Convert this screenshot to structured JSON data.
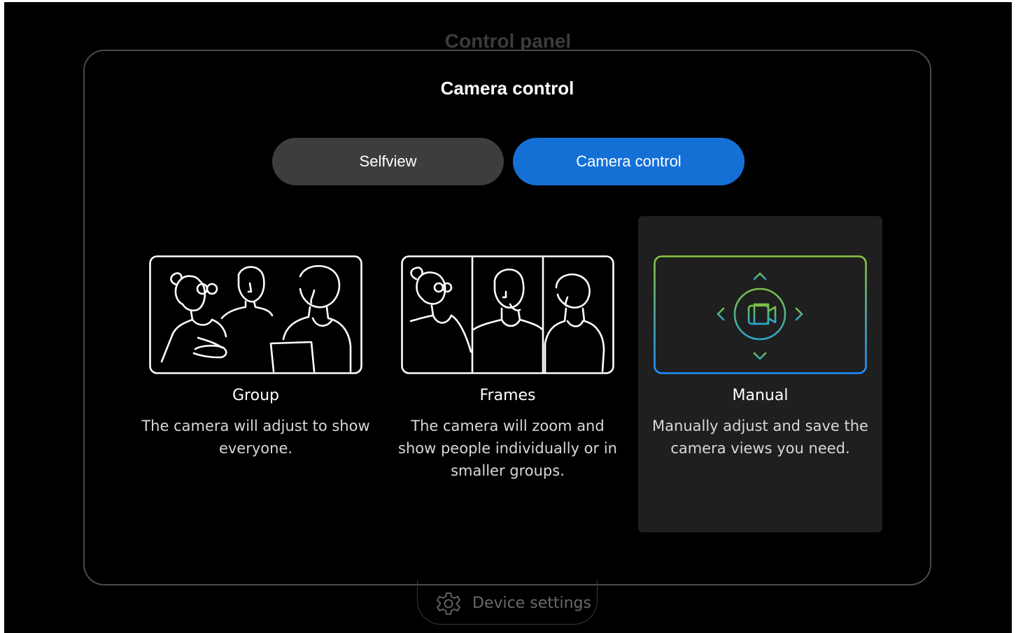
{
  "background": {
    "title": "Control panel"
  },
  "modal": {
    "title": "Camera control",
    "tabs": [
      {
        "label": "Selfview",
        "selected": false
      },
      {
        "label": "Camera control",
        "selected": true
      }
    ],
    "options": [
      {
        "label": "Group",
        "description": "The camera will adjust to show everyone.",
        "selected": false,
        "icon": "group-people-illustration"
      },
      {
        "label": "Frames",
        "description": "The camera will zoom and show people individually or in smaller groups.",
        "selected": false,
        "icon": "frames-people-illustration"
      },
      {
        "label": "Manual",
        "description": "Manually adjust and save the camera views you need.",
        "selected": true,
        "icon": "manual-camera-pan-icon"
      }
    ]
  },
  "footer": {
    "device_settings_label": "Device settings",
    "icon": "gear-icon"
  },
  "colors": {
    "accent": "#1570d6",
    "manual_gradient_start": "#8cc63f",
    "manual_gradient_end": "#1e90ff"
  }
}
